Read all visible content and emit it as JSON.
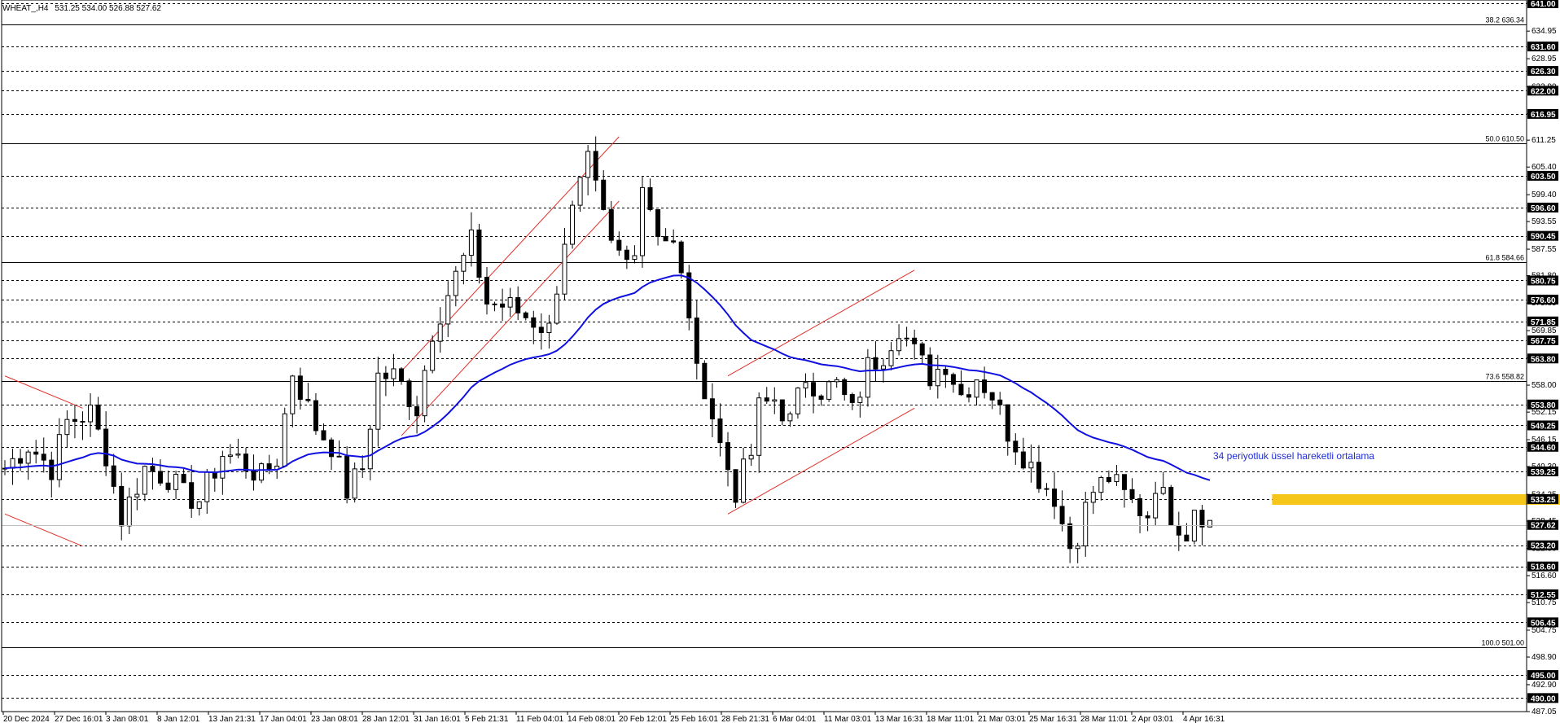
{
  "header": {
    "symbol": "WHEAT_,H4",
    "ohlc": "531.25 534.00 526.88 527.62"
  },
  "annotation": {
    "text": "34 periyotluk üssel hareketli ortalama",
    "color": "#1e2bd6"
  },
  "colors": {
    "candle": "#000000",
    "ema": "#1010e0",
    "channel": "#e0302a",
    "zone": "#f5c518",
    "grid": "#000000",
    "label_bg": "#000000",
    "label_fg": "#ffffff"
  },
  "chart_data": {
    "type": "candlestick",
    "title": "",
    "ylim": [
      487.05,
      641.0
    ],
    "y_ticks": [
      "641.00",
      "634.95",
      "628.95",
      "622.90",
      "616.95",
      "611.25",
      "605.40",
      "599.40",
      "593.55",
      "587.55",
      "581.80",
      "575.85",
      "569.85",
      "563.90",
      "558.00",
      "552.15",
      "546.15",
      "540.30",
      "534.25",
      "528.45",
      "522.50",
      "516.60",
      "510.75",
      "504.75",
      "498.90",
      "492.90",
      "487.05"
    ],
    "x_ticks": [
      "20 Dec 2024",
      "27 Dec 16:01",
      "3 Jan 08:01",
      "8 Jan 12:01",
      "13 Jan 21:31",
      "17 Jan 04:01",
      "23 Jan 08:01",
      "28 Jan 12:01",
      "31 Jan 16:01",
      "5 Feb 21:31",
      "11 Feb 04:01",
      "14 Feb 08:01",
      "20 Feb 12:01",
      "25 Feb 16:01",
      "28 Feb 21:31",
      "6 Mar 04:01",
      "11 Mar 03:01",
      "13 Mar 16:31",
      "18 Mar 11:01",
      "21 Mar 03:01",
      "25 Mar 16:31",
      "28 Mar 11:01",
      "2 Apr 03:01",
      "4 Apr 16:31"
    ],
    "levels": [
      "641.00",
      "631.60",
      "626.30",
      "622.00",
      "616.95",
      "603.50",
      "596.60",
      "590.45",
      "580.75",
      "576.60",
      "571.85",
      "567.75",
      "563.80",
      "553.80",
      "549.25",
      "544.60",
      "539.25",
      "533.25",
      "527.62",
      "523.20",
      "518.60",
      "512.55",
      "506.45",
      "495.00",
      "490.00"
    ],
    "fib_levels": [
      {
        "label": "38.2 636.34",
        "value": 636.34
      },
      {
        "label": "50.0 610.50",
        "value": 610.5
      },
      {
        "label": "61.8 584.66",
        "value": 584.66
      },
      {
        "label": "73.6 558.82",
        "value": 558.82
      },
      {
        "label": "100.0 501.00",
        "value": 501.0
      }
    ],
    "current_price": 527.62,
    "zone": {
      "from": 532.0,
      "to": 534.3,
      "start_index": 163,
      "end_index": 213
    },
    "ema_period": 34,
    "channels": [
      {
        "name": "ch1",
        "upper": [
          [
            0,
            560.0
          ],
          [
            10,
            553.0
          ]
        ],
        "lower": [
          [
            0,
            530.0
          ],
          [
            10,
            523.0
          ]
        ]
      },
      {
        "name": "ch2",
        "upper": [
          [
            51,
            561.0
          ],
          [
            79,
            612.0
          ]
        ],
        "lower": [
          [
            51,
            547.0
          ],
          [
            79,
            598.0
          ]
        ]
      },
      {
        "name": "ch3",
        "upper": [
          [
            93,
            560.0
          ],
          [
            117,
            583.0
          ]
        ],
        "lower": [
          [
            93,
            530.0
          ],
          [
            117,
            553.0
          ]
        ]
      }
    ],
    "pivots": [
      [
        0,
        540
      ],
      [
        3,
        545
      ],
      [
        6,
        540
      ],
      [
        8,
        550
      ],
      [
        11,
        552
      ],
      [
        13,
        543
      ],
      [
        15,
        529
      ],
      [
        18,
        540
      ],
      [
        21,
        538
      ],
      [
        23,
        534
      ],
      [
        25,
        533
      ],
      [
        28,
        543
      ],
      [
        30,
        542
      ],
      [
        33,
        538
      ],
      [
        35,
        542
      ],
      [
        37,
        561
      ],
      [
        40,
        549
      ],
      [
        42,
        545
      ],
      [
        44,
        535
      ],
      [
        46,
        540
      ],
      [
        48,
        560
      ],
      [
        50,
        560
      ],
      [
        51,
        558
      ],
      [
        53,
        553
      ],
      [
        55,
        570
      ],
      [
        57,
        578
      ],
      [
        60,
        589
      ],
      [
        62,
        576
      ],
      [
        65,
        575
      ],
      [
        67,
        573
      ],
      [
        70,
        570
      ],
      [
        72,
        590
      ],
      [
        74,
        601
      ],
      [
        75,
        606
      ],
      [
        76,
        600
      ],
      [
        78,
        588
      ],
      [
        80,
        585
      ],
      [
        81,
        589
      ],
      [
        82,
        602
      ],
      [
        84,
        592
      ],
      [
        86,
        588
      ],
      [
        88,
        574
      ],
      [
        89,
        560
      ],
      [
        90,
        558
      ],
      [
        92,
        545
      ],
      [
        94,
        535
      ],
      [
        96,
        543
      ],
      [
        97,
        553
      ],
      [
        99,
        555
      ],
      [
        101,
        550
      ],
      [
        103,
        560
      ],
      [
        105,
        557
      ],
      [
        107,
        558
      ],
      [
        109,
        552
      ],
      [
        111,
        562
      ],
      [
        113,
        565
      ],
      [
        115,
        571
      ],
      [
        117,
        565
      ],
      [
        119,
        560
      ],
      [
        121,
        563
      ],
      [
        123,
        556
      ],
      [
        125,
        560
      ],
      [
        127,
        556
      ],
      [
        129,
        548
      ],
      [
        131,
        543
      ],
      [
        133,
        538
      ],
      [
        135,
        534
      ],
      [
        136,
        528
      ],
      [
        137,
        523
      ],
      [
        138,
        526
      ],
      [
        139,
        531
      ],
      [
        140,
        535
      ],
      [
        142,
        538
      ],
      [
        144,
        534
      ],
      [
        146,
        531
      ],
      [
        147,
        530
      ],
      [
        148,
        537
      ],
      [
        150,
        530
      ],
      [
        152,
        526
      ],
      [
        153,
        532
      ],
      [
        155,
        528
      ]
    ],
    "candle_count": 156
  }
}
